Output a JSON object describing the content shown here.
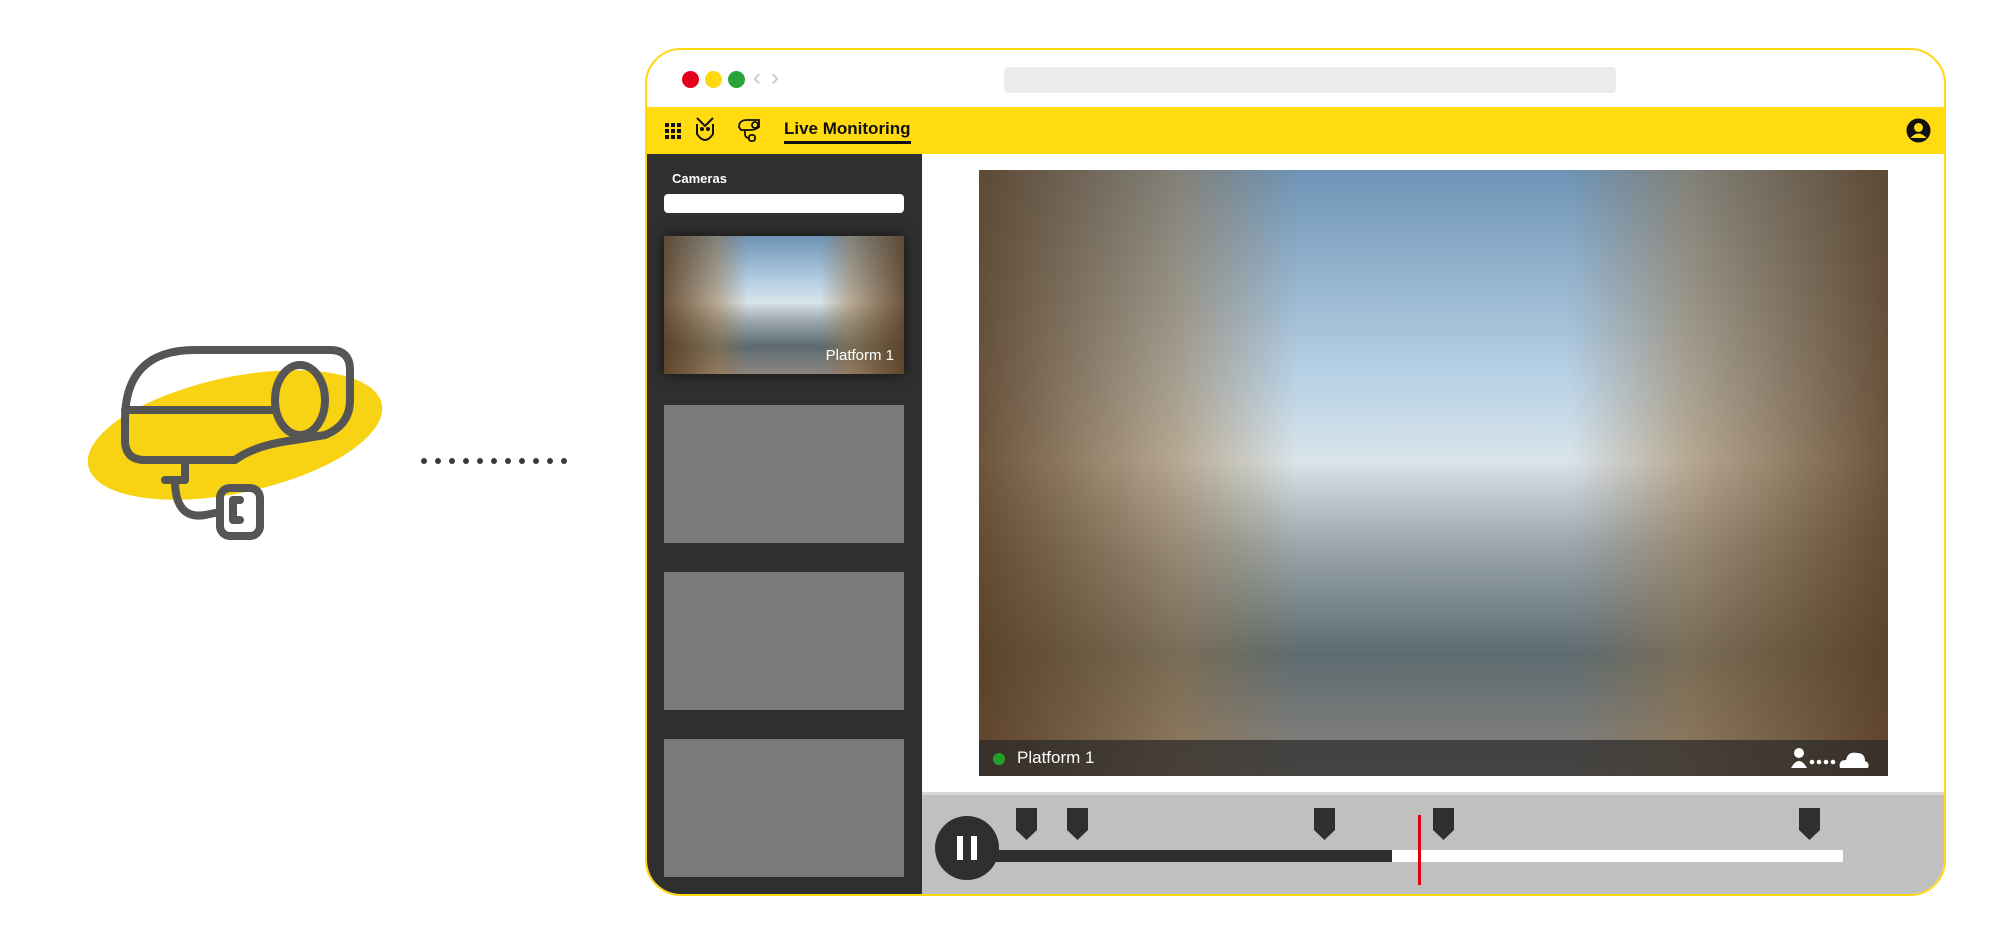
{
  "browser": {
    "back_icon": "chevron-left",
    "forward_icon": "chevron-right",
    "traffic_lights": [
      "#e2001a",
      "#ffd80f",
      "#2aa43a"
    ]
  },
  "header": {
    "title": "Live Monitoring",
    "icons": [
      "grid-icon",
      "owl-logo-icon",
      "camera-icon",
      "user-account-icon"
    ],
    "accent": "#ffdb10"
  },
  "sidebar": {
    "label": "Cameras",
    "search_value": "",
    "cameras": [
      {
        "name": "Platform 1"
      },
      {
        "name": ""
      },
      {
        "name": ""
      },
      {
        "name": ""
      }
    ]
  },
  "video": {
    "camera_name": "Platform 1",
    "status": "online",
    "status_color": "#24a02a",
    "icons": [
      "person-icon",
      "dots-icon",
      "cloud-icon"
    ]
  },
  "timeline": {
    "state": "playing",
    "button_icon": "pause-icon",
    "progress_fraction": 0.47,
    "playhead_fraction": 0.5,
    "event_marker_fractions": [
      0.04,
      0.1,
      0.39,
      0.53,
      0.96
    ],
    "playhead_color": "#e00010"
  }
}
